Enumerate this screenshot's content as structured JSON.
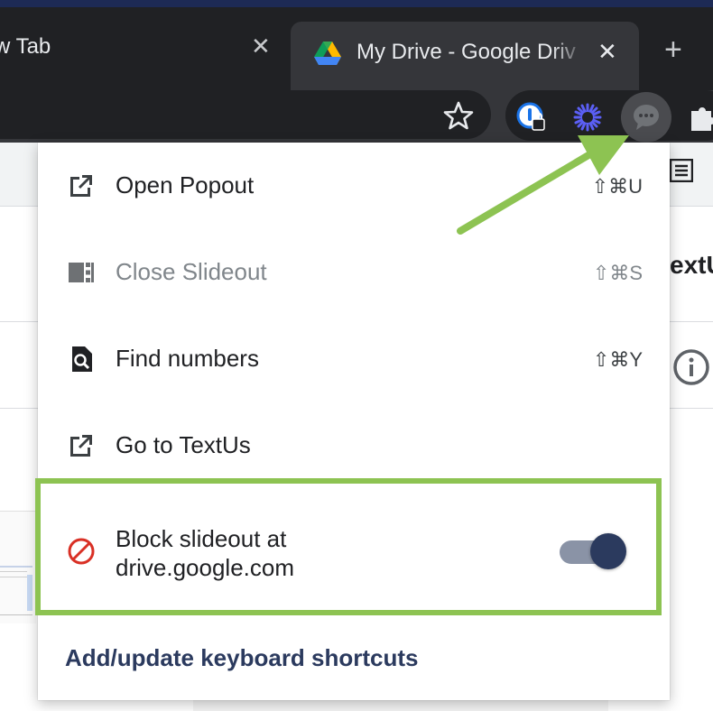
{
  "browser": {
    "tabs": [
      {
        "label": "w Tab",
        "active": false
      },
      {
        "label": "My Drive - Google Driv",
        "active": true
      }
    ],
    "new_tab_symbol": "+",
    "close_symbol": "✕"
  },
  "page_background": {
    "right_text": "extU"
  },
  "menu": {
    "items": [
      {
        "label": "Open Popout",
        "shortcut": "⇧⌘U",
        "icon": "open-external-icon",
        "disabled": false
      },
      {
        "label": "Close Slideout",
        "shortcut": "⇧⌘S",
        "icon": "slideout-panel-icon",
        "disabled": true
      },
      {
        "label": "Find numbers",
        "shortcut": "⇧⌘Y",
        "icon": "search-document-icon",
        "disabled": false
      },
      {
        "label": "Go to TextUs",
        "shortcut": "",
        "icon": "open-external-icon",
        "disabled": false
      }
    ],
    "block": {
      "line1": "Block slideout at",
      "line2": "drive.google.com",
      "icon": "block-icon",
      "toggle_on": true
    },
    "footer_link": "Add/update keyboard shortcuts"
  },
  "colors": {
    "highlight": "#8dc352",
    "accent_navy": "#2b3a5e",
    "block_red": "#d93025",
    "tab_dark": "#202124"
  }
}
